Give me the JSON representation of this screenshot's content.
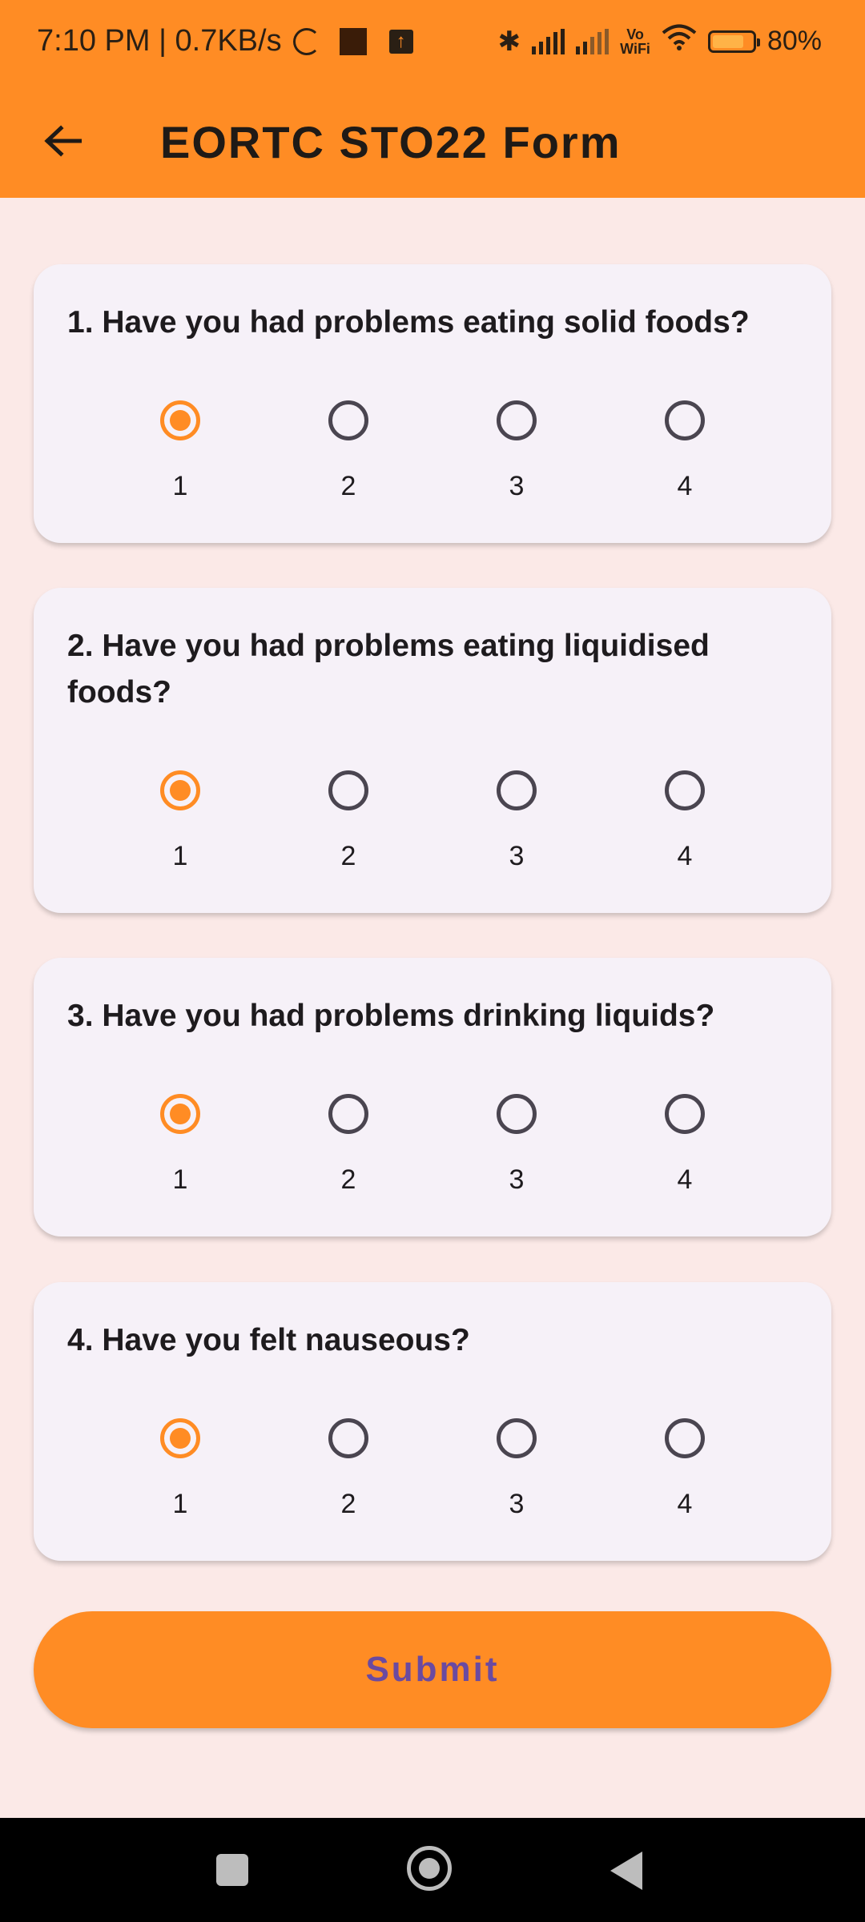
{
  "status_bar": {
    "time_speed": "7:10 PM | 0.7KB/s",
    "battery": "80%",
    "vowifi_top": "Vo",
    "vowifi_bottom": "WiFi",
    "battery_level": 0.8
  },
  "app_bar": {
    "title": "EORTC STO22 Form",
    "back_icon": "arrow-left-icon"
  },
  "questions": [
    {
      "text": "1. Have you had problems eating solid foods?",
      "options": [
        "1",
        "2",
        "3",
        "4"
      ],
      "selected": "1"
    },
    {
      "text": "2. Have you had problems eating liquidised foods?",
      "options": [
        "1",
        "2",
        "3",
        "4"
      ],
      "selected": "1"
    },
    {
      "text": "3. Have you had problems drinking liquids?",
      "options": [
        "1",
        "2",
        "3",
        "4"
      ],
      "selected": "1"
    },
    {
      "text": "4. Have you felt nauseous?",
      "options": [
        "1",
        "2",
        "3",
        "4"
      ],
      "selected": "1"
    }
  ],
  "submit": {
    "label": "Submit"
  },
  "colors": {
    "accent": "#ff8c24",
    "background": "#fbe9e7",
    "card": "#f6f1f8",
    "submit_text": "#6b4aa0"
  }
}
